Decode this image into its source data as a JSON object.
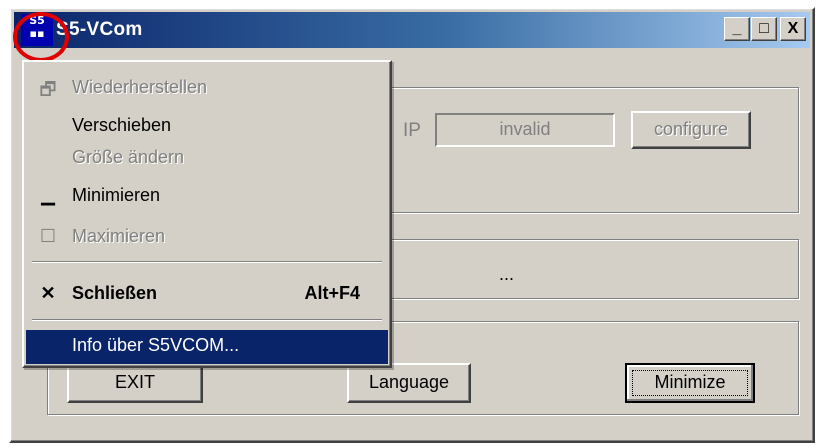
{
  "window": {
    "title": "S5-VCom",
    "icon_label": "S5",
    "controls": {
      "minimize": "_",
      "maximize": "□",
      "close": "X"
    }
  },
  "connection": {
    "ip_label": "IP",
    "ip_value": "invalid",
    "configure_label": "configure"
  },
  "status": {
    "text": "..."
  },
  "buttons": {
    "exit": "EXIT",
    "language": "Language",
    "minimize": "Minimize"
  },
  "system_menu": {
    "items": [
      {
        "label": "Wiederherstellen",
        "icon": "restore-icon",
        "glyph": "🗗",
        "enabled": false
      },
      {
        "label": "Verschieben",
        "icon": "",
        "glyph": "",
        "enabled": true
      },
      {
        "label": "Größe ändern",
        "icon": "",
        "glyph": "",
        "enabled": false
      },
      {
        "label": "Minimieren",
        "icon": "minimize-icon",
        "glyph": "▁",
        "enabled": true
      },
      {
        "label": "Maximieren",
        "icon": "maximize-icon",
        "glyph": "☐",
        "enabled": false
      },
      {
        "label": "Schließen",
        "icon": "close-icon",
        "glyph": "✕",
        "accelerator": "Alt+F4",
        "enabled": true,
        "default": true
      },
      {
        "label": "Info über S5VCOM...",
        "icon": "",
        "glyph": "",
        "enabled": true,
        "selected": true
      }
    ]
  },
  "colors": {
    "face": "#d4d0c8",
    "title_start": "#0a246a",
    "title_end": "#a6caf0",
    "highlight": "#e00000"
  }
}
